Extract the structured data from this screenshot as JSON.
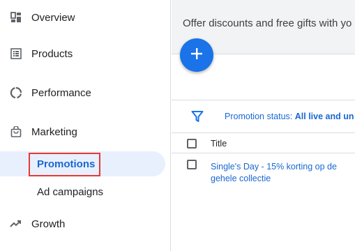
{
  "sidebar": {
    "items": [
      {
        "label": "Overview",
        "icon": "dashboard-icon"
      },
      {
        "label": "Products",
        "icon": "list-icon"
      },
      {
        "label": "Performance",
        "icon": "donut-chart-icon"
      },
      {
        "label": "Marketing",
        "icon": "shopping-bag-icon"
      },
      {
        "label": "Growth",
        "icon": "trending-up-icon"
      }
    ],
    "marketing_subitems": [
      {
        "label": "Promotions",
        "active": true
      },
      {
        "label": "Ad campaigns",
        "active": false
      }
    ]
  },
  "main": {
    "banner_text": "Offer discounts and free gifts with yo",
    "add_button_icon": "plus-icon",
    "filter": {
      "label": "Promotion status: ",
      "value": "All live and un"
    },
    "table": {
      "columns": [
        "Title"
      ],
      "rows": [
        {
          "title": "Single's Day - 15% korting op de gehele collectie"
        }
      ]
    }
  },
  "colors": {
    "accent": "#1a73e8",
    "link": "#1967d2",
    "active_bg": "#e8f0fe",
    "highlight": "#e53935"
  }
}
